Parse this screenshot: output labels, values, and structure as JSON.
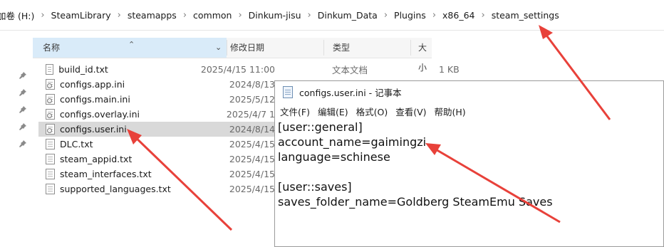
{
  "breadcrumb": [
    "加卷 (H:)",
    "SteamLibrary",
    "steamapps",
    "common",
    "Dinkum-jisu",
    "Dinkum_Data",
    "Plugins",
    "x86_64",
    "steam_settings"
  ],
  "columns": {
    "name": "名称",
    "date": "修改日期",
    "type": "类型",
    "size": "大小"
  },
  "files": [
    {
      "name": "build_id.txt",
      "date": "2025/4/15 11:00",
      "type": "文本文档",
      "size": "1 KB",
      "icon": "text-file-icon"
    },
    {
      "name": "configs.app.ini",
      "date": "2024/8/13",
      "type": "",
      "size": "",
      "icon": "ini-file-icon"
    },
    {
      "name": "configs.main.ini",
      "date": "2025/5/12",
      "type": "",
      "size": "",
      "icon": "ini-file-icon"
    },
    {
      "name": "configs.overlay.ini",
      "date": "2025/4/7 1",
      "type": "",
      "size": "",
      "icon": "ini-file-icon"
    },
    {
      "name": "configs.user.ini",
      "date": "2024/8/14",
      "type": "",
      "size": "",
      "icon": "ini-file-icon",
      "selected": true
    },
    {
      "name": "DLC.txt",
      "date": "2025/4/15",
      "type": "",
      "size": "",
      "icon": "text-file-icon"
    },
    {
      "name": "steam_appid.txt",
      "date": "2025/4/15",
      "type": "",
      "size": "",
      "icon": "text-file-icon"
    },
    {
      "name": "steam_interfaces.txt",
      "date": "2025/4/15",
      "type": "",
      "size": "",
      "icon": "text-file-icon"
    },
    {
      "name": "supported_languages.txt",
      "date": "2025/4/15",
      "type": "",
      "size": "",
      "icon": "text-file-icon"
    }
  ],
  "notepad": {
    "title": "configs.user.ini - 记事本",
    "menu": [
      "文件(F)",
      "编辑(E)",
      "格式(O)",
      "查看(V)",
      "帮助(H)"
    ],
    "lines": [
      "[user::general]",
      "account_name=gaimingzi",
      "language=schinese",
      "",
      "[user::saves]",
      "saves_folder_name=Goldberg SteamEmu Saves"
    ]
  },
  "colors": {
    "arrow": "#e8413a",
    "selection": "#d9d9d9",
    "header_active": "#d9ebf9"
  }
}
